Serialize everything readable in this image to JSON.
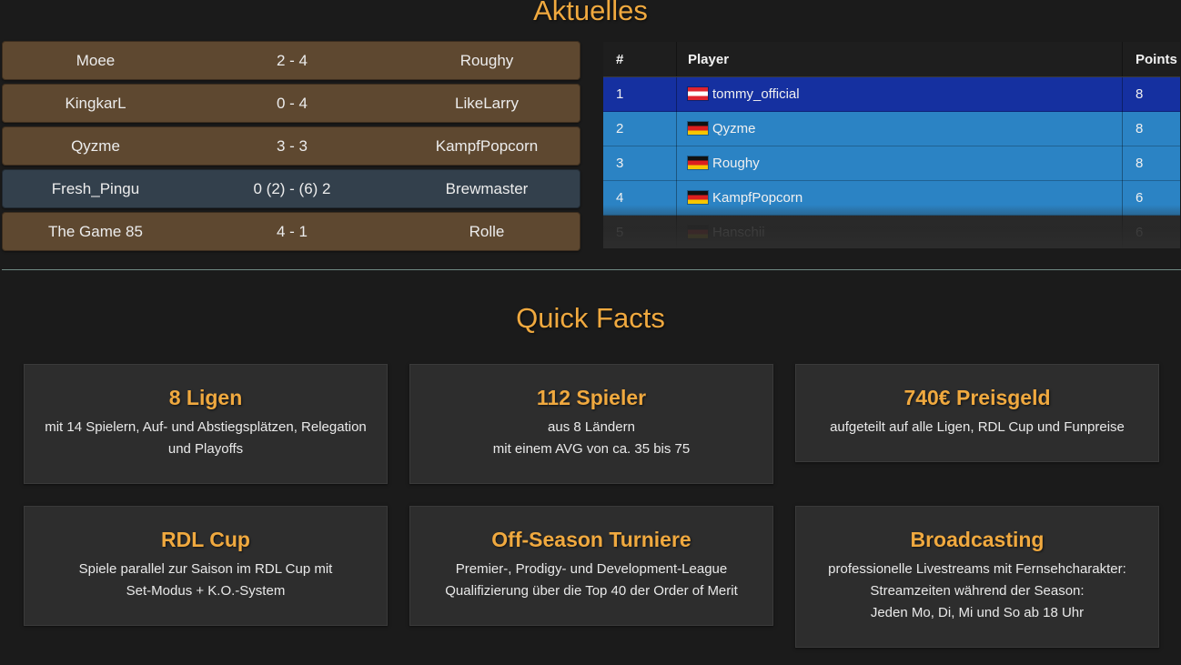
{
  "sections": {
    "aktuelles_title": "Aktuelles",
    "quickfacts_title": "Quick Facts"
  },
  "matches": [
    {
      "home": "Moee",
      "score": "2 - 4",
      "away": "Roughy",
      "status": "finished"
    },
    {
      "home": "KingkarL",
      "score": "0 - 4",
      "away": "LikeLarry",
      "status": "finished"
    },
    {
      "home": "Qyzme",
      "score": "3 - 3",
      "away": "KampfPopcorn",
      "status": "finished"
    },
    {
      "home": "Fresh_Pingu",
      "score": "0 (2) - (6) 2",
      "away": "Brewmaster",
      "status": "live"
    },
    {
      "home": "The Game 85",
      "score": "4 - 1",
      "away": "Rolle",
      "status": "finished"
    }
  ],
  "standings": {
    "headers": {
      "rank": "#",
      "player": "Player",
      "points": "Points"
    },
    "rows": [
      {
        "rank": "1",
        "player": "tommy_official",
        "points": "8",
        "flag": "at-flag-icon"
      },
      {
        "rank": "2",
        "player": "Qyzme",
        "points": "8",
        "flag": "de-flag-icon"
      },
      {
        "rank": "3",
        "player": "Roughy",
        "points": "8",
        "flag": "de-flag-icon"
      },
      {
        "rank": "4",
        "player": "KampfPopcorn",
        "points": "6",
        "flag": "de-flag-icon"
      },
      {
        "rank": "5",
        "player": "Hanschii",
        "points": "6",
        "flag": "de-flag-icon"
      }
    ]
  },
  "facts": {
    "ligen": {
      "title": "8 Ligen",
      "lines": [
        "mit 14 Spielern, Auf- und Abstiegsplätzen, Relegation",
        "und Playoffs"
      ]
    },
    "spieler": {
      "title": "112 Spieler",
      "lines": [
        "aus 8 Ländern",
        "mit einem AVG von ca. 35 bis 75"
      ]
    },
    "preisgeld": {
      "title": "740€ Preisgeld",
      "lines": [
        "aufgeteilt auf alle Ligen, RDL Cup und Funpreise"
      ]
    },
    "cup": {
      "title": "RDL Cup",
      "lines": [
        "Spiele parallel zur Saison im RDL Cup mit",
        "Set-Modus + K.O.-System"
      ]
    },
    "offseason": {
      "title": "Off-Season Turniere",
      "lines": [
        "Premier-, Prodigy- und Development-League",
        "Qualifizierung über die Top 40 der Order of Merit"
      ]
    },
    "broadcasting": {
      "title": "Broadcasting",
      "lines": [
        "professionelle Livestreams mit Fernsehcharakter:",
        "Streamzeiten während der Season:",
        "Jeden Mo, Di, Mi und So ab 18 Uhr"
      ]
    }
  },
  "colors": {
    "accent": "#f0a93f",
    "background": "#1b1b1b",
    "match_finished": "#5e4830",
    "match_live": "#33404c",
    "standings_first": "#1530a0",
    "standings_other": "#2b83c4",
    "card_background": "#2d2d2d"
  }
}
